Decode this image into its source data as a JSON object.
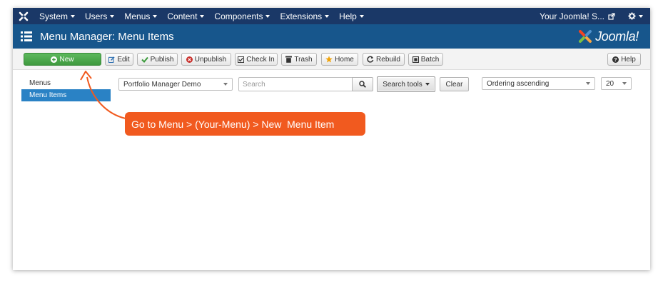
{
  "navbar": {
    "logo_icon": "joomla-x-icon",
    "menu": [
      {
        "label": "System"
      },
      {
        "label": "Users"
      },
      {
        "label": "Menus"
      },
      {
        "label": "Content"
      },
      {
        "label": "Components"
      },
      {
        "label": "Extensions"
      },
      {
        "label": "Help"
      }
    ],
    "site_label": "Your Joomla! S...",
    "site_icon": "external-link-icon",
    "settings_icon": "gear-icon"
  },
  "header": {
    "title": "Menu Manager: Menu Items",
    "icon": "list-icon",
    "brand": "Joomla!"
  },
  "toolbar": {
    "new_label": "New",
    "edit_label": "Edit",
    "publish_label": "Publish",
    "unpublish_label": "Unpublish",
    "checkin_label": "Check In",
    "trash_label": "Trash",
    "home_label": "Home",
    "rebuild_label": "Rebuild",
    "batch_label": "Batch",
    "help_label": "Help"
  },
  "sidebar": {
    "items": [
      {
        "label": "Menus",
        "active": false
      },
      {
        "label": "Menu Items",
        "active": true
      }
    ]
  },
  "filters": {
    "menu_select": "Portfolio Manager Demo",
    "search_placeholder": "Search",
    "search_tools_label": "Search tools",
    "clear_label": "Clear",
    "ordering_select": "Ordering ascending",
    "limit_select": "20"
  },
  "annotation": {
    "text": "Go to Menu > (Your-Menu) > New  Menu Item",
    "color": "#f15a1f"
  },
  "colors": {
    "navbar": "#1a3867",
    "header": "#17568c",
    "active_sidebar": "#2a82c5",
    "new_button": "#4cae4c"
  }
}
